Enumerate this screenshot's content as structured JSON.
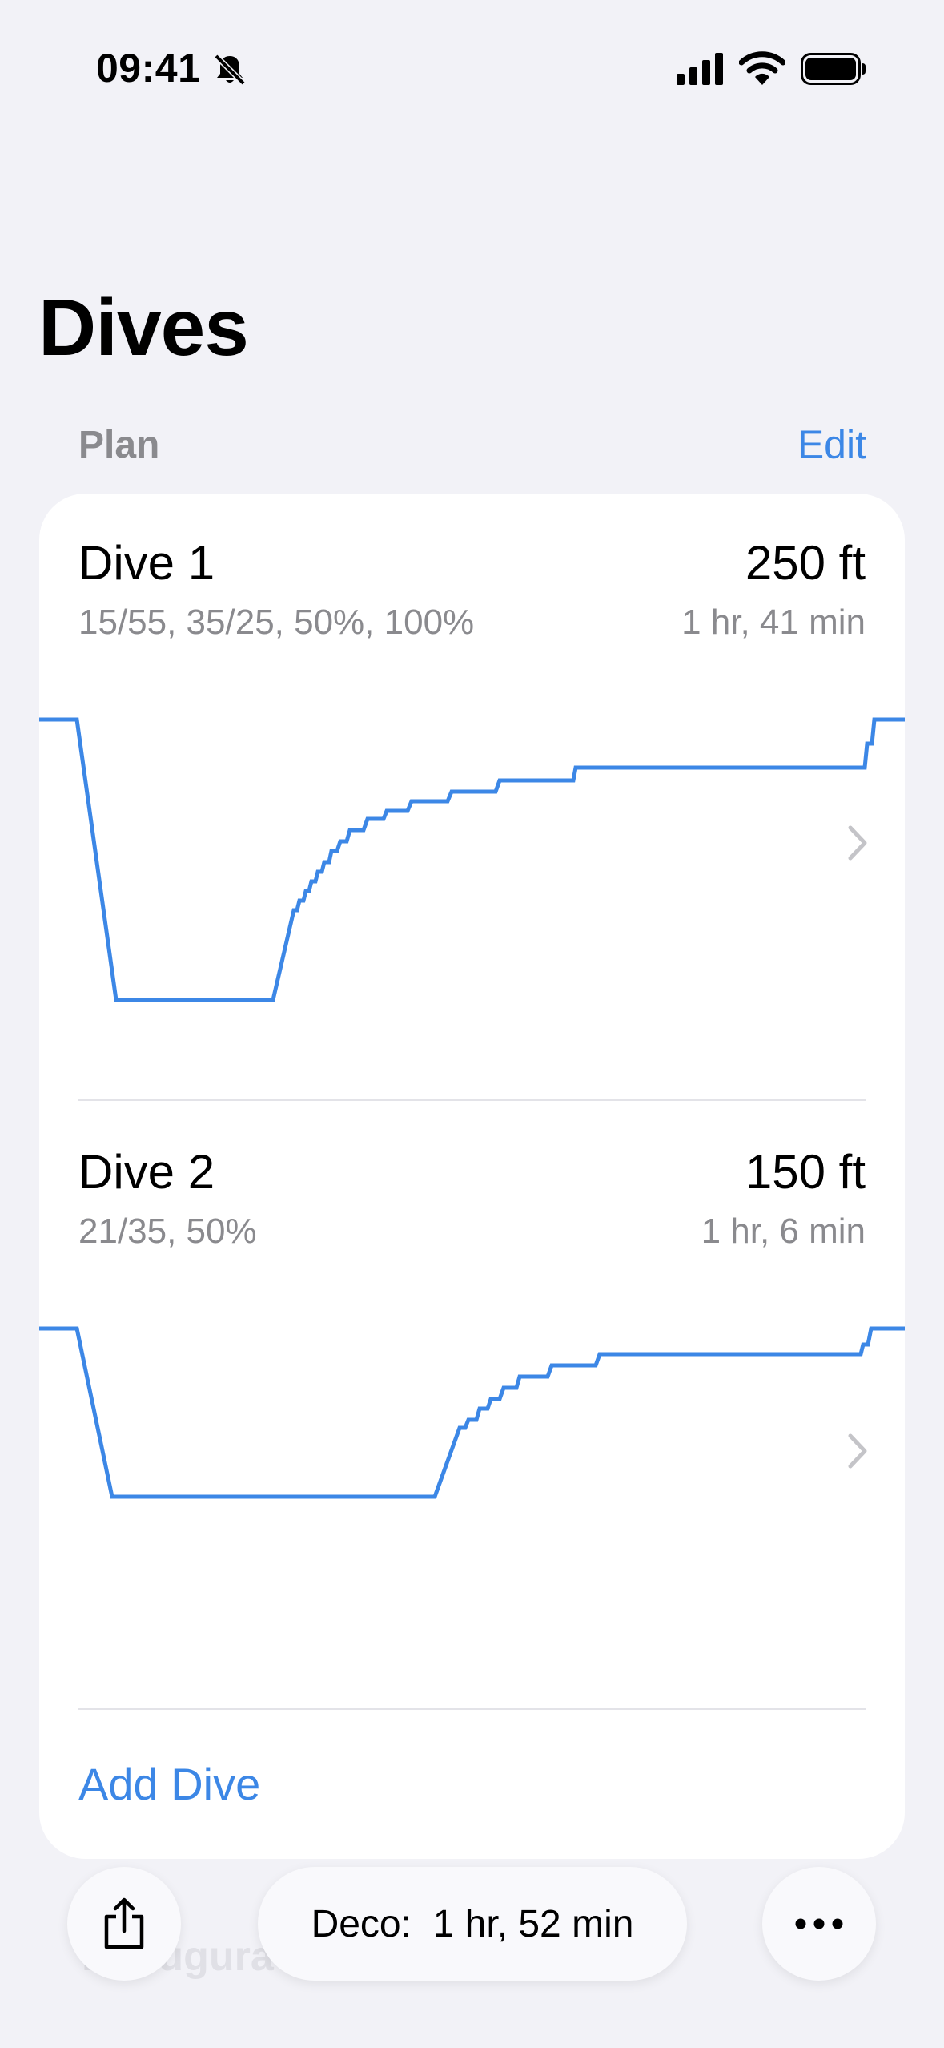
{
  "status_bar": {
    "time": "09:41"
  },
  "header": {
    "title": "Dives"
  },
  "section": {
    "label": "Plan",
    "edit_label": "Edit"
  },
  "dives": [
    {
      "title": "Dive 1",
      "gases": "15/55, 35/25, 50%, 100%",
      "depth": "250 ft",
      "duration": "1 hr, 41 min"
    },
    {
      "title": "Dive 2",
      "gases": "21/35, 50%",
      "depth": "150 ft",
      "duration": "1 hr, 6 min"
    }
  ],
  "add_dive_label": "Add Dive",
  "toolbar": {
    "deco_label": "Deco:",
    "deco_value": "1 hr, 52 min"
  },
  "watermark": "Kaeugura Pop",
  "colors": {
    "accent": "#3c87e6",
    "background": "#f2f2f7",
    "secondary_text": "#8a8a8e"
  },
  "icons": [
    "bell-slash-icon",
    "cellular-signal-icon",
    "wifi-icon",
    "battery-icon",
    "chevron-right-icon",
    "share-icon",
    "more-icon"
  ]
}
